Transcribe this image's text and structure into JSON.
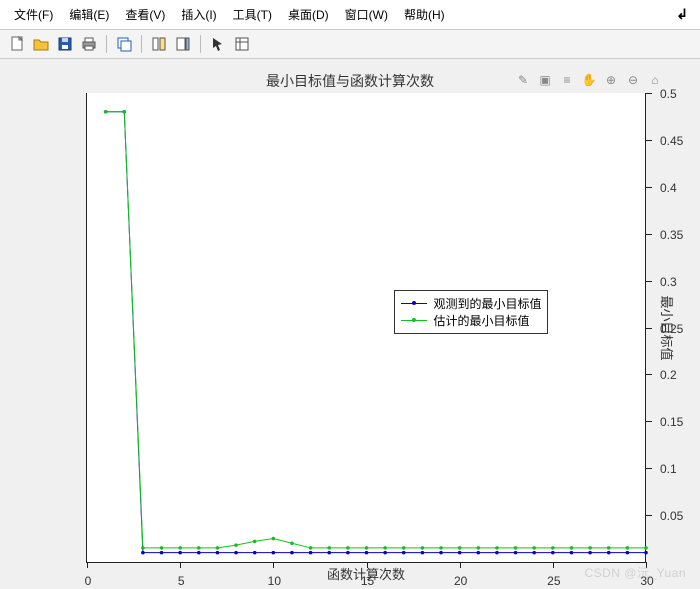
{
  "menu": {
    "items": [
      {
        "label": "文件(F)"
      },
      {
        "label": "编辑(E)"
      },
      {
        "label": "查看(V)"
      },
      {
        "label": "插入(I)"
      },
      {
        "label": "工具(T)"
      },
      {
        "label": "桌面(D)"
      },
      {
        "label": "窗口(W)"
      },
      {
        "label": "帮助(H)"
      }
    ]
  },
  "toolbar": {
    "icons": [
      "new-file-icon",
      "open-folder-icon",
      "save-icon",
      "print-icon",
      "sep",
      "duplicate-figure-icon",
      "sep",
      "link-axes-icon",
      "insert-colorbar-icon",
      "sep",
      "pointer-icon",
      "annotate-icon"
    ]
  },
  "figtools": {
    "icons": [
      "brush-icon",
      "highlight-icon",
      "data-cursor-icon",
      "pan-icon",
      "zoom-in-icon",
      "zoom-out-icon",
      "home-icon"
    ]
  },
  "chart_data": {
    "type": "line",
    "title": "最小目标值与函数计算次数",
    "xlabel": "函数计算次数",
    "ylabel_right": "最小目标值",
    "xlim": [
      0,
      30
    ],
    "ylim": [
      0,
      0.5
    ],
    "xticks": [
      0,
      5,
      10,
      15,
      20,
      25,
      30
    ],
    "yticks": [
      0.05,
      0.1,
      0.15,
      0.2,
      0.25,
      0.3,
      0.35,
      0.4,
      0.45,
      0.5
    ],
    "legend": {
      "position": {
        "left_pct": 55,
        "top_pct": 42
      },
      "entries": [
        "观测到的最小目标值",
        "估计的最小目标值"
      ]
    },
    "series": [
      {
        "name": "观测到的最小目标值",
        "color": "#0a00c4",
        "x": [
          1,
          2,
          3,
          4,
          5,
          6,
          7,
          8,
          9,
          10,
          11,
          12,
          13,
          14,
          15,
          16,
          17,
          18,
          19,
          20,
          21,
          22,
          23,
          24,
          25,
          26,
          27,
          28,
          29,
          30
        ],
        "y": [
          0.48,
          0.48,
          0.01,
          0.01,
          0.01,
          0.01,
          0.01,
          0.01,
          0.01,
          0.01,
          0.01,
          0.01,
          0.01,
          0.01,
          0.01,
          0.01,
          0.01,
          0.01,
          0.01,
          0.01,
          0.01,
          0.01,
          0.01,
          0.01,
          0.01,
          0.01,
          0.01,
          0.01,
          0.01,
          0.01
        ]
      },
      {
        "name": "估计的最小目标值",
        "color": "#11c21e",
        "x": [
          1,
          2,
          3,
          4,
          5,
          6,
          7,
          8,
          9,
          10,
          11,
          12,
          13,
          14,
          15,
          16,
          17,
          18,
          19,
          20,
          21,
          22,
          23,
          24,
          25,
          26,
          27,
          28,
          29,
          30
        ],
        "y": [
          0.48,
          0.48,
          0.015,
          0.015,
          0.015,
          0.015,
          0.015,
          0.018,
          0.022,
          0.025,
          0.02,
          0.015,
          0.015,
          0.015,
          0.015,
          0.015,
          0.015,
          0.015,
          0.015,
          0.015,
          0.015,
          0.015,
          0.015,
          0.015,
          0.015,
          0.015,
          0.015,
          0.015,
          0.015,
          0.015
        ]
      }
    ]
  },
  "watermark": "CSDN @沅_Yuan"
}
